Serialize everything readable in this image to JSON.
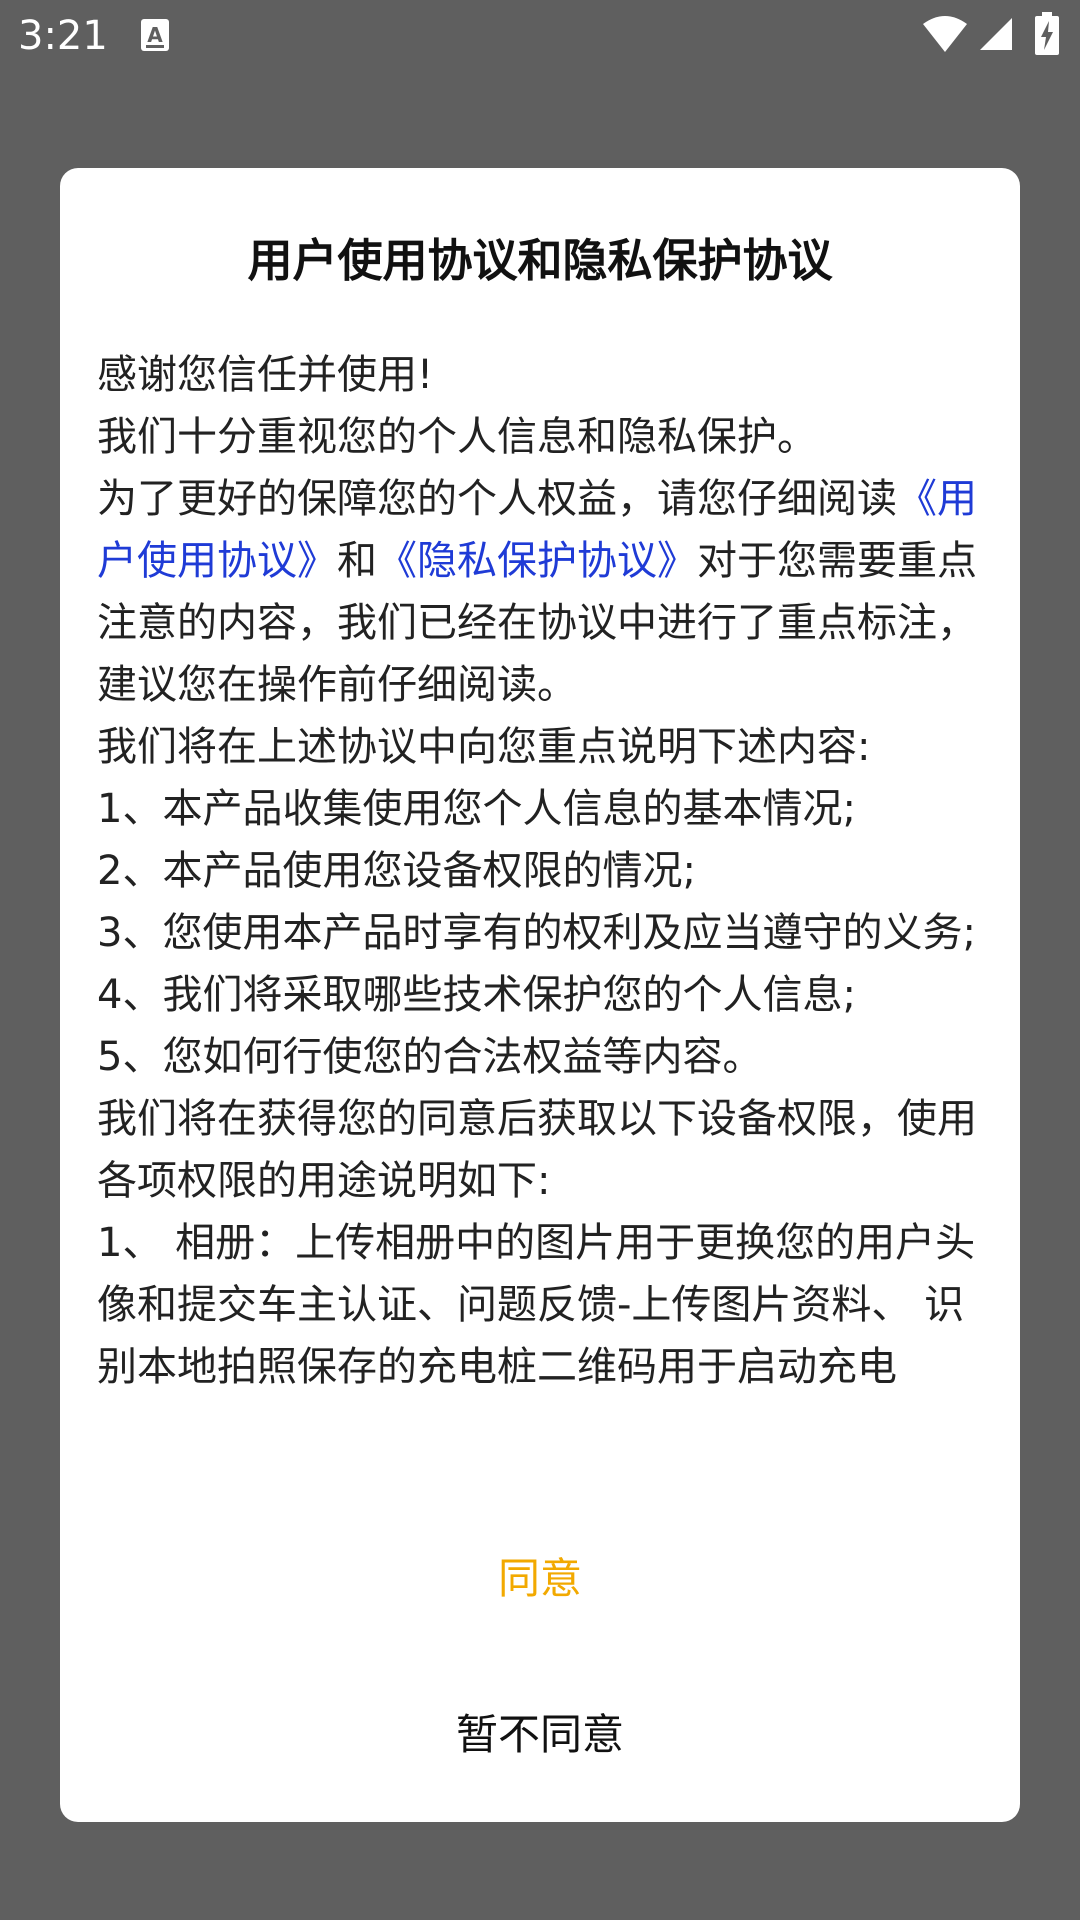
{
  "status_bar": {
    "time": "3:21",
    "icons": [
      "notification-a-icon",
      "wifi-icon",
      "signal-icon",
      "battery-charging-icon"
    ]
  },
  "dialog": {
    "title": "用户使用协议和隐私保护协议",
    "body": {
      "line1": "感谢您信任并使用!",
      "line2": "我们十分重视您的个人信息和隐私保护。",
      "line3_prefix": "为了更好的保障您的个人权益，请您仔细阅读",
      "link_user_agreement": "《用户使用协议》",
      "conjunction": "和",
      "link_privacy_agreement": "《隐私保护协议》",
      "line3_suffix": "对于您需要重点注意的内容，我们已经在协议中进行了重点标注，建议您在操作前仔细阅读。",
      "line4": "我们将在上述协议中向您重点说明下述内容:",
      "item1": "1、本产品收集使用您个人信息的基本情况;",
      "item2": "2、本产品使用您设备权限的情况;",
      "item3": "3、您使用本产品时享有的权利及应当遵守的义务;",
      "item4": "4、我们将采取哪些技术保护您的个人信息;",
      "item5": "5、您如何行使您的合法权益等内容。",
      "line5": "我们将在获得您的同意后获取以下设备权限，使用各项权限的用途说明如下:",
      "perm1": "1、 相册：上传相册中的图片用于更换您的用户头像和提交车主认证、问题反馈-上传图片资料、 识别本地拍照保存的充电桩二维码用于启动充电"
    },
    "agree_label": "同意",
    "disagree_label": "暂不同意"
  },
  "colors": {
    "backdrop": "#5f5f5f",
    "link": "#1f3bd6",
    "agree": "#f2a900"
  }
}
